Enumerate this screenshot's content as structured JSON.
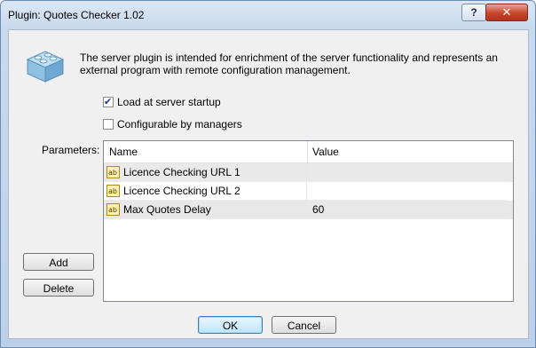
{
  "window": {
    "title": "Plugin: Quotes Checker 1.02",
    "help_label": "?",
    "close_label": "✕"
  },
  "description": "The server plugin is intended for enrichment of the server functionality and represents an external program with remote configuration management.",
  "options": {
    "load_at_startup": {
      "label": "Load at server startup",
      "checked": true
    },
    "configurable_by_managers": {
      "label": "Configurable by managers",
      "checked": false
    }
  },
  "parameters": {
    "label": "Parameters:",
    "columns": [
      "Name",
      "Value"
    ],
    "rows": [
      {
        "name": "Licence Checking URL 1",
        "value": ""
      },
      {
        "name": "Licence Checking URL 2",
        "value": ""
      },
      {
        "name": "Max Quotes Delay",
        "value": "60"
      }
    ]
  },
  "buttons": {
    "add": "Add",
    "delete": "Delete",
    "ok": "OK",
    "cancel": "Cancel"
  }
}
